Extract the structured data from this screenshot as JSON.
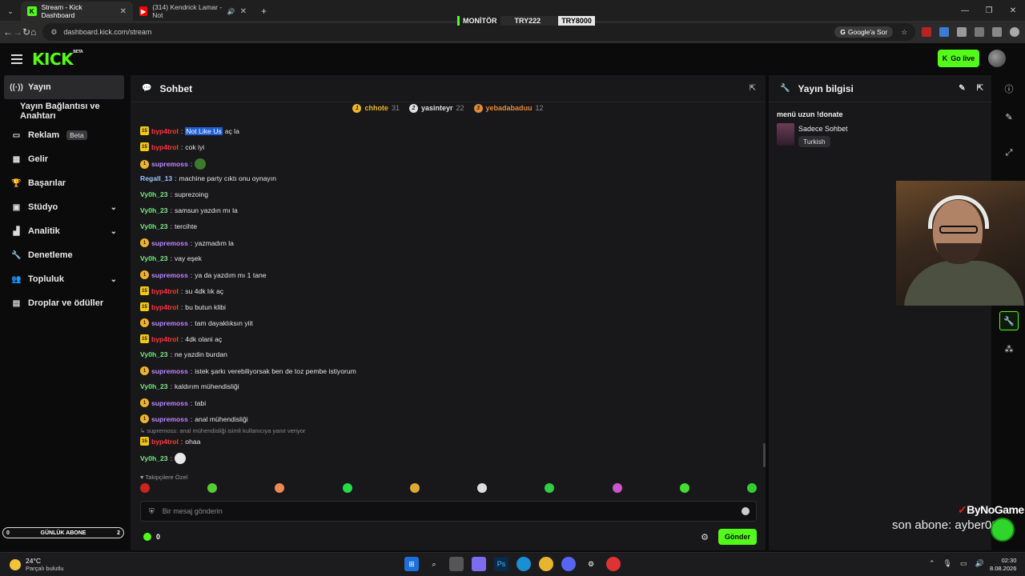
{
  "browser": {
    "tabs": [
      {
        "title": "Stream - Kick Dashboard",
        "active": true
      },
      {
        "title": "(314) Kendrick Lamar - Not",
        "active": false
      }
    ],
    "url": "dashboard.kick.com/stream",
    "google_sor": "Google'a Sor",
    "ticker": [
      "MONİTÖR",
      "TRY222",
      "TRY8000"
    ]
  },
  "topbar": {
    "logo": "KICK",
    "logo_sup": "BETA",
    "go_live": "Go live"
  },
  "sidebar": {
    "items": [
      {
        "label": "Yayın",
        "icon": "broadcast-icon",
        "active": true
      },
      {
        "label": "Yayın Bağlantısı ve Anahtarı",
        "sub": true
      },
      {
        "label": "Reklam",
        "badge": "Beta",
        "icon": "ad-icon"
      },
      {
        "label": "Gelir",
        "icon": "revenue-icon"
      },
      {
        "label": "Başarılar",
        "icon": "trophy-icon"
      },
      {
        "label": "Stüdyo",
        "icon": "studio-icon",
        "expand": true
      },
      {
        "label": "Analitik",
        "icon": "analytics-icon",
        "expand": true
      },
      {
        "label": "Denetleme",
        "icon": "wrench-icon"
      },
      {
        "label": "Topluluk",
        "icon": "community-icon",
        "expand": true
      },
      {
        "label": "Droplar ve ödüller",
        "icon": "drops-icon"
      }
    ],
    "daily_sub_label": "GÜNLÜK ABONE",
    "daily_sub_left": "0",
    "daily_sub_right": "2"
  },
  "chat": {
    "title": "Sohbet",
    "top_gifters": [
      {
        "name": "chhote",
        "count": "31",
        "color": "#f0b429"
      },
      {
        "name": "yasinteyr",
        "count": "22",
        "color": "#e0e0e0"
      },
      {
        "name": "yebadabaduu",
        "count": "12",
        "color": "#e08a3c"
      }
    ],
    "messages": [
      {
        "user": "byp4trol",
        "color": "#ff3b3b",
        "badge": "15",
        "highlight": "Not Like Us",
        "text": " aç la"
      },
      {
        "user": "byp4trol",
        "color": "#ff3b3b",
        "badge": "15",
        "text": "cok iyi"
      },
      {
        "user": "supremoss",
        "color": "#c186ff",
        "badge": "1",
        "emote": true,
        "text": ""
      },
      {
        "user": "Regall_13",
        "color": "#9bc4ff",
        "text": "machine party cıktı onu oynayın"
      },
      {
        "user": "Vy0h_23",
        "color": "#7ee787",
        "text": "suprezoing"
      },
      {
        "user": "Vy0h_23",
        "color": "#7ee787",
        "text": "samsun yazdın mı la"
      },
      {
        "user": "Vy0h_23",
        "color": "#7ee787",
        "text": "tercihte"
      },
      {
        "user": "supremoss",
        "color": "#c186ff",
        "badge": "1",
        "text": "yazmadım la"
      },
      {
        "user": "Vy0h_23",
        "color": "#7ee787",
        "text": "vay eşek"
      },
      {
        "user": "supremoss",
        "color": "#c186ff",
        "badge": "1",
        "text": "ya da yazdım mı 1 tane"
      },
      {
        "user": "byp4trol",
        "color": "#ff3b3b",
        "badge": "15",
        "text": "su 4dk lık aç"
      },
      {
        "user": "byp4trol",
        "color": "#ff3b3b",
        "badge": "15",
        "text": "bu butun klibi"
      },
      {
        "user": "supremoss",
        "color": "#c186ff",
        "badge": "1",
        "text": "tam dayaklıksın yiit"
      },
      {
        "user": "byp4trol",
        "color": "#ff3b3b",
        "badge": "15",
        "text": "4dk olani aç"
      },
      {
        "user": "Vy0h_23",
        "color": "#7ee787",
        "text": "ne yazdin burdan"
      },
      {
        "user": "supremoss",
        "color": "#c186ff",
        "badge": "1",
        "text": "istek şarkı verebiliyorsak ben de toz pembe istiyorum"
      },
      {
        "user": "Vy0h_23",
        "color": "#7ee787",
        "text": "kaldırım mühendisliği"
      },
      {
        "user": "supremoss",
        "color": "#c186ff",
        "badge": "1",
        "text": "tabi"
      },
      {
        "user": "supremoss",
        "color": "#c186ff",
        "badge": "1",
        "text": "anal mühendisliği"
      },
      {
        "user": "byp4trol",
        "color": "#ff3b3b",
        "badge": "15",
        "text": "ohaa"
      },
      {
        "user": "Vy0h_23",
        "color": "#7ee787",
        "emote": true,
        "text": ""
      }
    ],
    "reply_note": "↳ supremoss: anal mühendisliği isimli kullanıcıya yanıt veriyor",
    "followers_only": "♥ Takipçilere Özel",
    "input_placeholder": "Bir mesaj gönderin",
    "points": "0",
    "send": "Gönder"
  },
  "info": {
    "title": "Yayın bilgisi",
    "stream_title": "menü uzun !donate",
    "category": "Sadece Sohbet",
    "language": "Turkish"
  },
  "overlay": {
    "brand": "ByNoGame",
    "last_sub": "son abone: ayber007"
  },
  "taskbar": {
    "temp": "24°C",
    "weather": "Parçalı bulutlu",
    "time": "02:30",
    "date": "8.08.2026"
  },
  "colors": {
    "accent": "#53fc18",
    "panel": "#18181b",
    "bg": "#0b0b0c"
  }
}
